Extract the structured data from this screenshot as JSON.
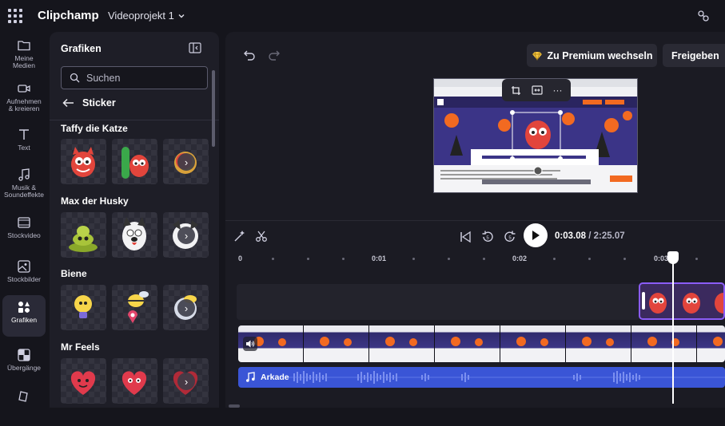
{
  "app": {
    "name": "Clipchamp",
    "project_name": "Videoprojekt 1"
  },
  "rail": [
    {
      "label": "Meine\nMedien",
      "icon": "folder-icon"
    },
    {
      "label": "Aufnehmen\n& kreieren",
      "icon": "camera-icon"
    },
    {
      "label": "Text",
      "icon": "text-icon"
    },
    {
      "label": "Musik &\nSoundeffekte",
      "icon": "music-icon"
    },
    {
      "label": "Stockvideo",
      "icon": "film-icon"
    },
    {
      "label": "Stockbilder",
      "icon": "image-icon"
    },
    {
      "label": "Grafiken",
      "icon": "shapes-icon",
      "active": true
    },
    {
      "label": "Übergänge",
      "icon": "transition-icon"
    },
    {
      "label": "",
      "icon": "brand-kit-icon"
    }
  ],
  "panel": {
    "title": "Grafiken",
    "search_placeholder": "Suchen",
    "back_label": "Sticker",
    "sections": [
      {
        "title": "Taffy die Katze"
      },
      {
        "title": "Max der Husky"
      },
      {
        "title": "Biene"
      },
      {
        "title": "Mr Feels"
      }
    ]
  },
  "header": {
    "premium_label": "Zu Premium wechseln",
    "share_label": "Freigeben"
  },
  "playback": {
    "current_time": "0:03.08",
    "separator": " / ",
    "total_time": "2:25.07"
  },
  "ruler": {
    "labels": [
      "0",
      "0:01",
      "0:02",
      "0:03"
    ]
  },
  "tracks": {
    "audio_name": "Arkade"
  },
  "colors": {
    "accent_purple": "#8b5cf6",
    "audio_blue": "#3a55d6",
    "premium_gold": "#f5c542"
  }
}
